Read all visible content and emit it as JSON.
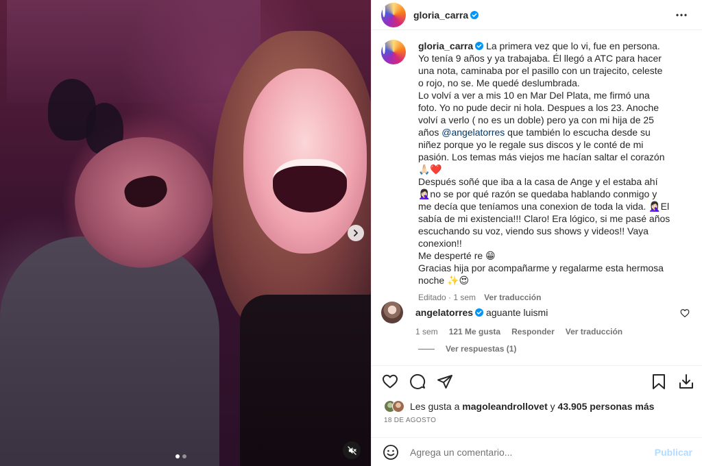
{
  "post": {
    "username": "gloria_carra",
    "verified": true
  },
  "media": {
    "slide_count": 2,
    "active_slide": 1,
    "icons": {
      "next": "chevron-right-icon",
      "mute": "speaker-muted-icon"
    }
  },
  "caption": {
    "username": "gloria_carra",
    "lines": [
      "La primera vez que lo vi, fue en persona. Yo tenía 9 años y ya trabajaba. Él llegó a ATC para hacer una nota, caminaba por el pasillo con un trajecito, celeste o rojo, no se. Me quedé deslumbrada.",
      "Lo volví a ver a mis 10 en Mar Del Plata, me firmó una foto. Yo no pude decir ni hola. Despues a los 23. Anoche volví a verlo ( no es un doble) pero ya con mi hija de 25 años ",
      "@angelatorres",
      " que también lo escucha desde su niñez porque yo le regale sus discos y le conté de mi pasión. Los temas más viejos me hacían saltar el corazón 🙏🏻❤️",
      "Después soñé que iba a la casa de Ange y el estaba ahí 🤦🏻‍♀️no se por qué razón se quedaba hablando conmigo y me decía que teníamos una conexion de toda la vida. 🤦🏻‍♀️El sabía de mi existencia!!! Claro! Era lógico, si me pasé años escuchando su voz, viendo sus shows y videos!! Vaya conexion!!",
      "Me desperté re 😁",
      "Gracias hija por acompañarme y regalarme esta hermosa noche ✨😍"
    ],
    "edited": "Editado",
    "time": "1 sem",
    "translate": "Ver traducción"
  },
  "comment": {
    "username": "angelatorres",
    "verified": true,
    "text": "aguante luismi",
    "time": "1 sem",
    "likes": "121 Me gusta",
    "reply": "Responder",
    "translate": "Ver traducción",
    "view_replies": "Ver respuestas (1)"
  },
  "actions": {
    "icons": [
      "heart-icon",
      "comment-icon",
      "share-icon",
      "bookmark-icon",
      "download-icon"
    ]
  },
  "likes": {
    "prefix": "Les gusta a ",
    "user": "magoleandrollovet",
    "middle": " y ",
    "count": "43.905 personas más"
  },
  "date": "18 DE AGOSTO",
  "add_comment": {
    "placeholder": "Agrega un comentario...",
    "publish": "Publicar"
  },
  "colors": {
    "text": "#262626",
    "secondary": "#737373",
    "verified": "#0095f6",
    "mention": "#00376b",
    "publish_disabled": "#b3dbff"
  }
}
